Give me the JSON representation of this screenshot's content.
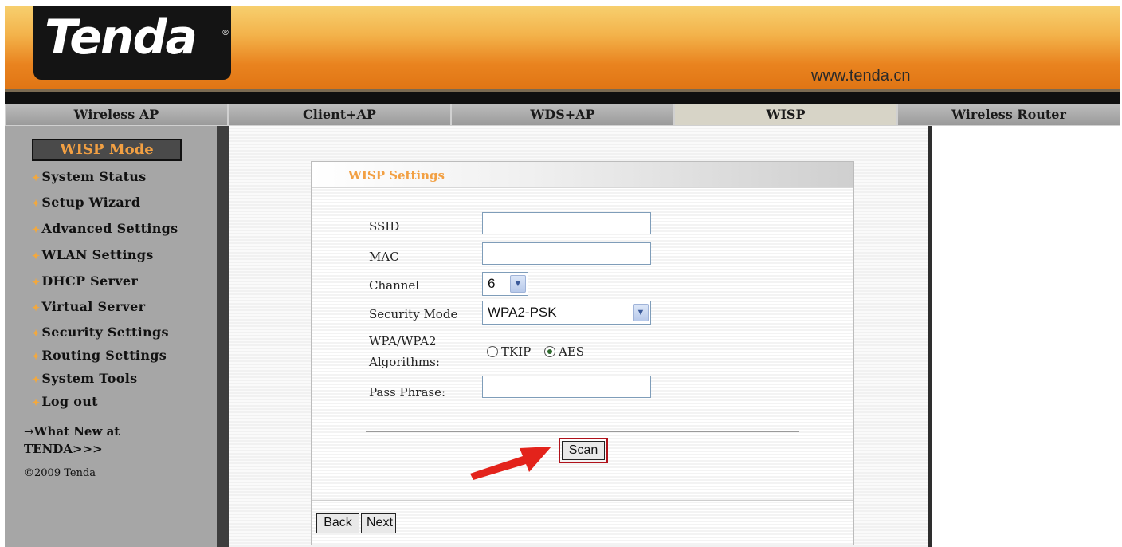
{
  "header": {
    "logo_text": "Tenda",
    "logo_reg": "®",
    "url": "www.tenda.cn"
  },
  "mode_tabs": [
    {
      "label": "Wireless AP",
      "active": false
    },
    {
      "label": "Client+AP",
      "active": false
    },
    {
      "label": "WDS+AP",
      "active": false
    },
    {
      "label": "WISP",
      "active": true
    },
    {
      "label": "Wireless Router",
      "active": false
    }
  ],
  "sidebar": {
    "title": "WISP Mode",
    "items": [
      {
        "label": "System Status"
      },
      {
        "label": "Setup Wizard"
      },
      {
        "label": "Advanced Settings"
      },
      {
        "label": "WLAN Settings"
      },
      {
        "label": "DHCP Server"
      },
      {
        "label": "Virtual Server"
      },
      {
        "label": "Security Settings"
      },
      {
        "label": "Routing Settings"
      },
      {
        "label": "System Tools"
      },
      {
        "label": "Log out"
      }
    ],
    "whats_new_line1": "→What New at",
    "whats_new_line2": "TENDA>>>",
    "copyright": "©2009 Tenda"
  },
  "panel": {
    "title": "WISP Settings",
    "ssid_label": "SSID",
    "ssid_value": "",
    "mac_label": "MAC",
    "mac_value": "",
    "channel_label": "Channel",
    "channel_value": "6",
    "security_label": "Security Mode",
    "security_value": "WPA2-PSK",
    "algorithms_label_line1": "WPA/WPA2",
    "algorithms_label_line2": "Algorithms:",
    "algorithm_options": [
      "TKIP",
      "AES"
    ],
    "algorithm_selected": "AES",
    "passphrase_label": "Pass Phrase:",
    "passphrase_value": "",
    "scan_label": "Scan",
    "back_label": "Back",
    "next_label": "Next"
  },
  "colors": {
    "accent_orange": "#f2a043",
    "highlight_red": "#b0121b",
    "arrow_red": "#e3231b"
  }
}
